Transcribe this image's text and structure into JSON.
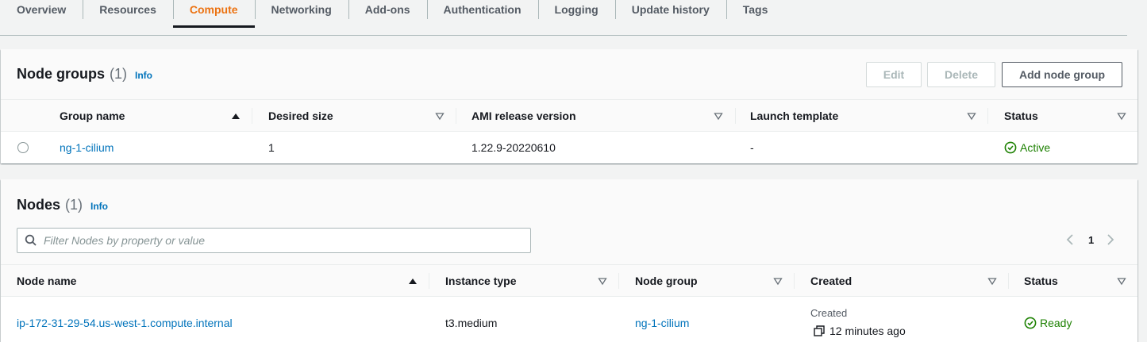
{
  "tabs": [
    {
      "label": "Overview"
    },
    {
      "label": "Resources"
    },
    {
      "label": "Compute"
    },
    {
      "label": "Networking"
    },
    {
      "label": "Add-ons"
    },
    {
      "label": "Authentication"
    },
    {
      "label": "Logging"
    },
    {
      "label": "Update history"
    },
    {
      "label": "Tags"
    }
  ],
  "active_tab": "Compute",
  "node_groups": {
    "title": "Node groups",
    "count": "(1)",
    "info": "Info",
    "edit_label": "Edit",
    "delete_label": "Delete",
    "add_label": "Add node group",
    "columns": [
      "Group name",
      "Desired size",
      "AMI release version",
      "Launch template",
      "Status"
    ],
    "row": {
      "group_name": "ng-1-cilium",
      "desired_size": "1",
      "ami_version": "1.22.9-20220610",
      "launch_template": "-",
      "status": "Active"
    }
  },
  "nodes": {
    "title": "Nodes",
    "count": "(1)",
    "info": "Info",
    "search_placeholder": "Filter Nodes by property or value",
    "page": "1",
    "columns": [
      "Node name",
      "Instance type",
      "Node group",
      "Created",
      "Status"
    ],
    "row": {
      "node_name": "ip-172-31-29-54.us-west-1.compute.internal",
      "instance_type": "t3.medium",
      "node_group": "ng-1-cilium",
      "created_label": "Created",
      "created_time": "12 minutes ago",
      "status": "Ready"
    }
  },
  "colors": {
    "accent": "#ec7211",
    "link": "#0073bb",
    "success": "#1d8102"
  }
}
